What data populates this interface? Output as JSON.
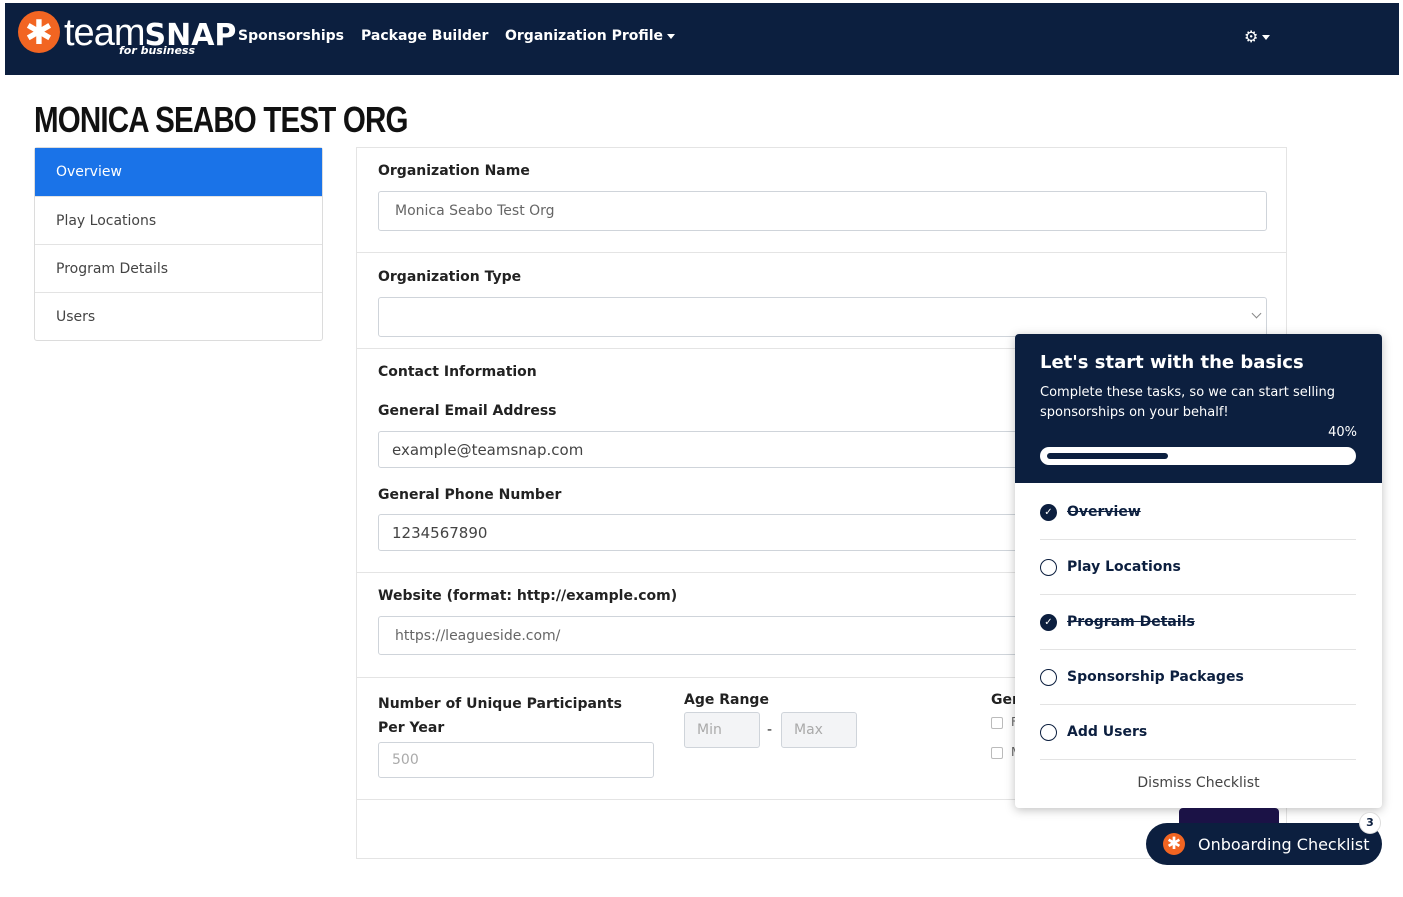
{
  "brand": {
    "name_a": "team",
    "name_b": "SNAP",
    "tagline": "for business",
    "logo_glyph": "✱",
    "accent": "#f26522",
    "navy": "#0c1f3f"
  },
  "nav": {
    "links": [
      "Sponsorships",
      "Package Builder",
      "Organization Profile"
    ],
    "settings_icon": "gear-icon"
  },
  "page": {
    "org_title": "MONICA SEABO TEST ORG"
  },
  "sidebar": {
    "items": [
      "Overview",
      "Play Locations",
      "Program Details",
      "Users"
    ],
    "active": "Overview"
  },
  "form": {
    "org_name": {
      "label": "Organization Name",
      "value": "Monica Seabo Test Org"
    },
    "org_type": {
      "label": "Organization Type",
      "value": ""
    },
    "contact": {
      "heading": "Contact Information",
      "email_label": "General Email Address",
      "email_value": "example@teamsnap.com",
      "phone_label": "General Phone Number",
      "phone_value": "1234567890"
    },
    "website": {
      "label": "Website (format: http://example.com)",
      "value": "https://leagueside.com/"
    },
    "participants": {
      "label": "Number of Unique Participants Per Year",
      "value": "500"
    },
    "age_range": {
      "label": "Age Range",
      "min_placeholder": "Min",
      "max_placeholder": "Max",
      "separator": "-"
    },
    "gender": {
      "label": "Ger",
      "opt1": "F",
      "opt2": "M"
    }
  },
  "checklist": {
    "title": "Let's start with the basics",
    "description": "Complete these tasks, so we can start selling sponsorships on your behalf!",
    "percent_label": "40%",
    "progress": 0.4,
    "tasks": [
      {
        "label": "Overview",
        "done": true
      },
      {
        "label": "Play Locations",
        "done": false
      },
      {
        "label": "Program Details",
        "done": true
      },
      {
        "label": "Sponsorship Packages",
        "done": false
      },
      {
        "label": "Add Users",
        "done": false
      }
    ],
    "dismiss": "Dismiss Checklist"
  },
  "onboarding": {
    "label": "Onboarding Checklist",
    "badge": "3"
  }
}
